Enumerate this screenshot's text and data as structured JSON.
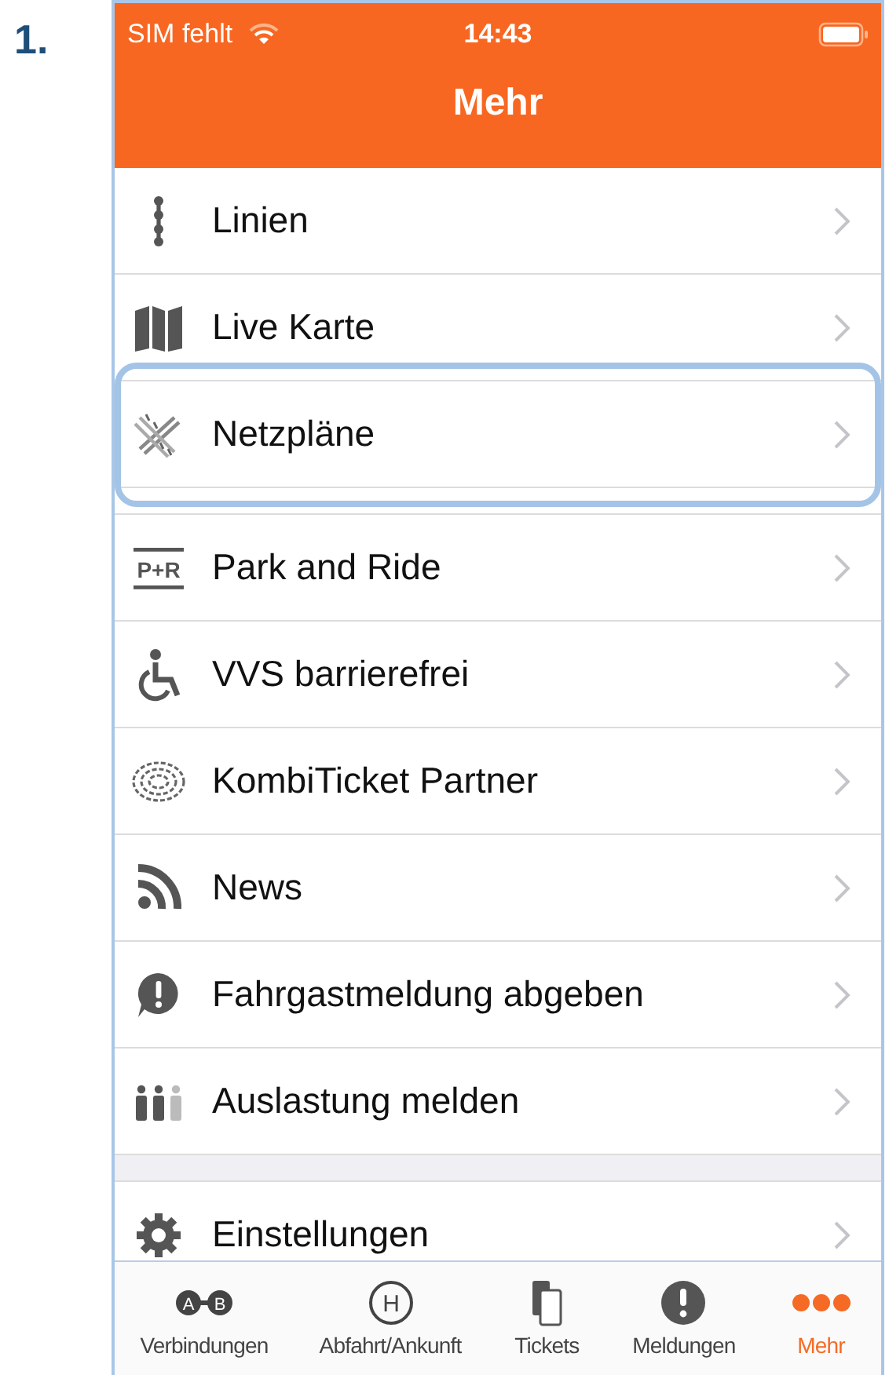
{
  "step_number": "1.",
  "status_bar": {
    "carrier": "SIM fehlt",
    "time": "14:43"
  },
  "nav_bar": {
    "title": "Mehr"
  },
  "sections": [
    {
      "items": [
        {
          "label": "Linien",
          "highlighted": false
        },
        {
          "label": "Live Karte",
          "highlighted": false
        },
        {
          "label": "Netzpläne",
          "highlighted": true
        }
      ]
    },
    {
      "items": [
        {
          "label": "Park and Ride",
          "highlighted": false,
          "icon_text": "P+R"
        },
        {
          "label": "VVS barrierefrei",
          "highlighted": false
        },
        {
          "label": "KombiTicket Partner",
          "highlighted": false
        },
        {
          "label": "News",
          "highlighted": false
        },
        {
          "label": "Fahrgastmeldung abgeben",
          "highlighted": false
        },
        {
          "label": "Auslastung melden",
          "highlighted": false
        }
      ]
    },
    {
      "items": [
        {
          "label": "Einstellungen",
          "highlighted": false
        }
      ]
    }
  ],
  "tab_bar": [
    {
      "label": "Verbindungen",
      "selected": false,
      "icon_letters": [
        "A",
        "B"
      ]
    },
    {
      "label": "Abfahrt/Ankunft",
      "selected": false,
      "icon_letters": [
        "H"
      ]
    },
    {
      "label": "Tickets",
      "selected": false
    },
    {
      "label": "Meldungen",
      "selected": false
    },
    {
      "label": "Mehr",
      "selected": true
    }
  ]
}
